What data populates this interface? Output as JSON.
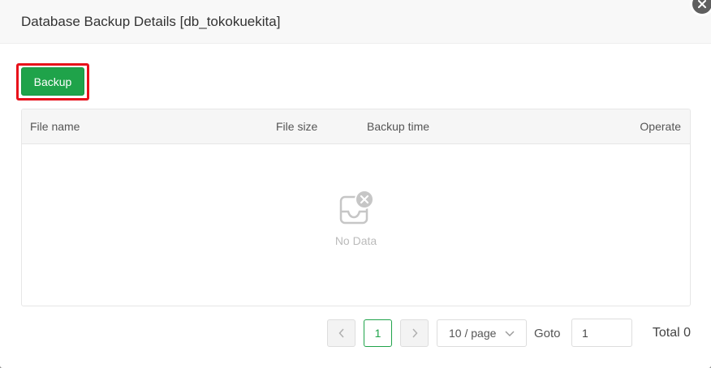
{
  "dialog": {
    "title": "Database Backup Details [db_tokokuekita]"
  },
  "toolbar": {
    "backup_label": "Backup"
  },
  "table": {
    "columns": [
      "File name",
      "File size",
      "Backup time",
      "Operate"
    ],
    "rows": [],
    "empty_text": "No Data"
  },
  "pagination": {
    "current_page": "1",
    "page_size": "10 / page",
    "goto_label": "Goto",
    "goto_value": "1",
    "total": "Total 0"
  },
  "colors": {
    "accent": "#1fa34a",
    "highlight": "#e8101a"
  }
}
